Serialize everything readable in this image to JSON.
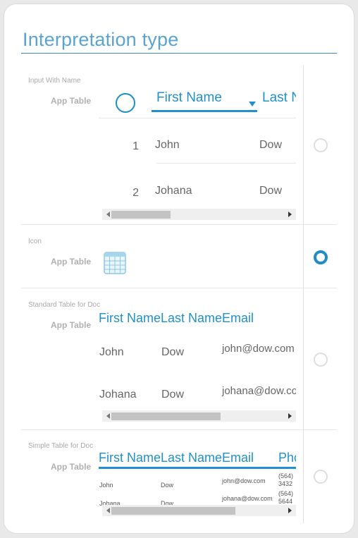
{
  "title": "Interpretation type",
  "options": [
    {
      "label": "Input With Name",
      "sublabel": "App Table",
      "selected": false,
      "preview": {
        "headers": [
          "First Name",
          "Last N"
        ],
        "rows": [
          {
            "num": "1",
            "first": "John",
            "last": "Dow"
          },
          {
            "num": "2",
            "first": "Johana",
            "last": "Dow"
          }
        ]
      }
    },
    {
      "label": "Icon",
      "sublabel": "App Table",
      "selected": true,
      "icon": "table-grid-icon"
    },
    {
      "label": "Standard Table for Doc",
      "sublabel": "App Table",
      "selected": false,
      "preview": {
        "header": "First NameLast NameEmail",
        "rows": [
          {
            "first": "John",
            "last": "Dow",
            "email": "john@dow.com"
          },
          {
            "first": "Johana",
            "last": "Dow",
            "email": "johana@dow.com"
          }
        ]
      }
    },
    {
      "label": "Simple Table for Doc",
      "sublabel": "App Table",
      "selected": false,
      "preview": {
        "header": "First NameLast NameEmail",
        "header_extra": "Phone",
        "rows": [
          {
            "first": "John",
            "last": "Dow",
            "email": "john@dow.com",
            "phone1": "(564)",
            "phone2": "3432"
          },
          {
            "first": "Johana",
            "last": "Dow",
            "email": "johana@dow.com",
            "phone1": "(564)",
            "phone2": "5644"
          }
        ]
      }
    }
  ],
  "colors": {
    "accent": "#2190cc",
    "radio_checked": "#1e8cc7",
    "title": "#5aa4d0"
  }
}
